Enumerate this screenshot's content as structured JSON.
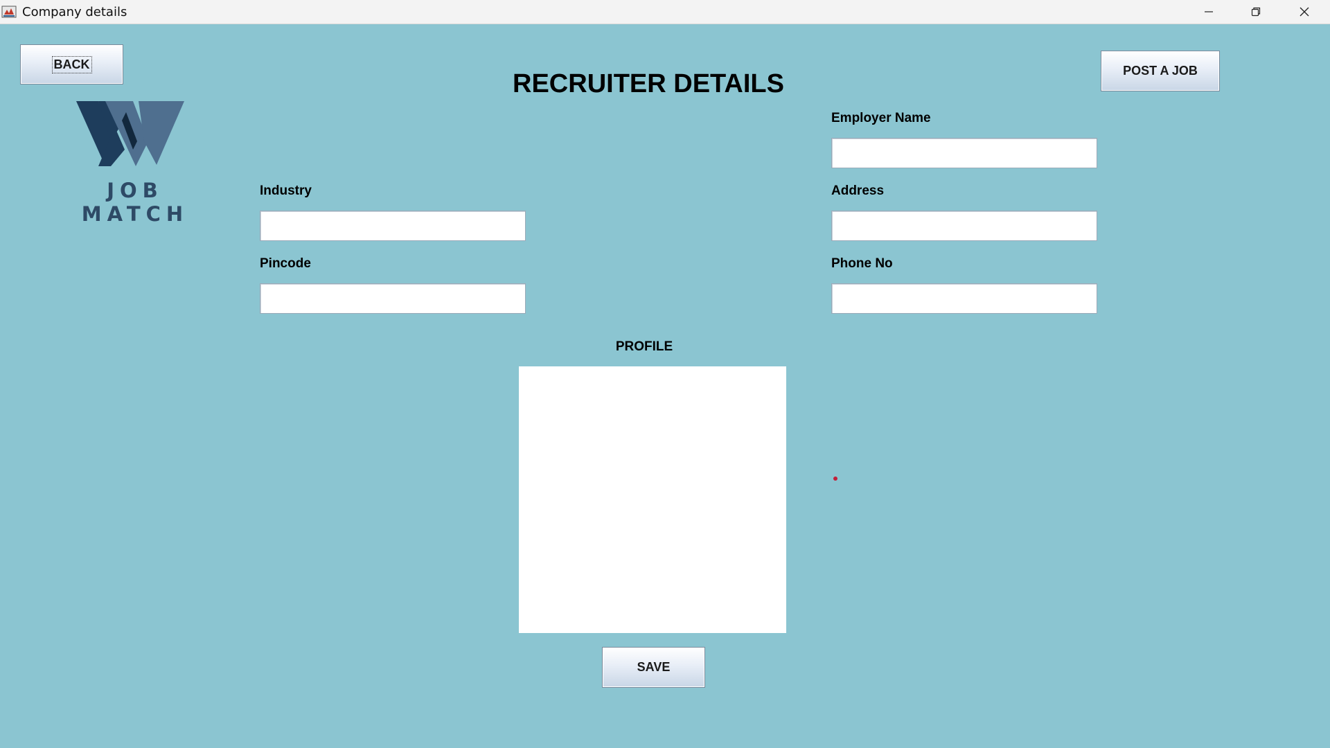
{
  "window": {
    "title": "Company details",
    "controls": [
      "minimize-icon",
      "restore-icon",
      "close-icon"
    ]
  },
  "toolbar": {
    "back_label": "BACK",
    "post_job_label": "POST A JOB",
    "save_label": "SAVE"
  },
  "logo": {
    "brand_text": "JOB MATCH",
    "icon": "w-logo-icon"
  },
  "page": {
    "heading": "RECRUITER DETAILS"
  },
  "form": {
    "employer_name": {
      "label": "Employer Name",
      "value": ""
    },
    "industry": {
      "label": "Industry",
      "value": ""
    },
    "address": {
      "label": "Address",
      "value": ""
    },
    "pincode": {
      "label": "Pincode",
      "value": ""
    },
    "phone_no": {
      "label": "Phone No",
      "value": ""
    },
    "profile": {
      "label": "PROFILE"
    }
  },
  "colors": {
    "background": "#8bc5d1",
    "logo_dark": "#1e3d5c",
    "logo_light": "#4f6f8f",
    "accent_dot": "#c2203a"
  }
}
